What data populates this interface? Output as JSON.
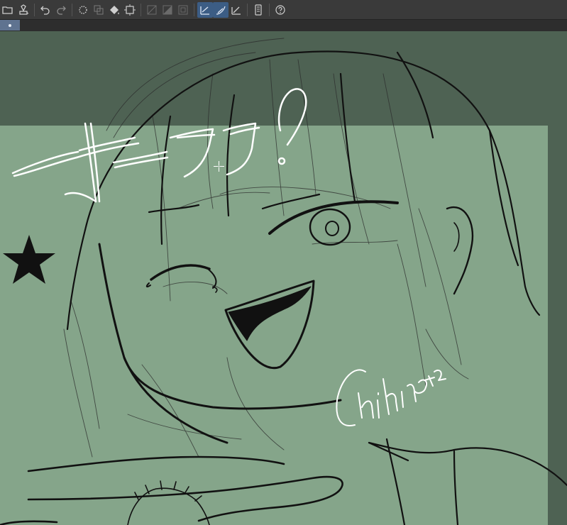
{
  "toolbar": {
    "tools": [
      {
        "name": "open-file-icon",
        "active": false
      },
      {
        "name": "save-file-icon",
        "active": false
      },
      {
        "name": "undo-icon",
        "active": false
      },
      {
        "name": "redo-icon",
        "active": false
      },
      {
        "name": "clear-icon",
        "active": false
      },
      {
        "name": "cut-icon",
        "active": false
      },
      {
        "name": "fill-icon",
        "active": false
      },
      {
        "name": "transform-icon",
        "active": false
      },
      {
        "name": "select-all-icon",
        "active": false
      },
      {
        "name": "invert-selection-icon",
        "active": false
      },
      {
        "name": "deselect-icon",
        "active": false
      },
      {
        "name": "snap-to-ruler-icon",
        "active": true
      },
      {
        "name": "snap-to-special-ruler-icon",
        "active": true
      },
      {
        "name": "snap-to-grid-icon",
        "active": false
      },
      {
        "name": "device-icon",
        "active": false
      },
      {
        "name": "help-icon",
        "active": false
      }
    ]
  },
  "colors": {
    "toolbar_bg": "#3a3a3a",
    "canvas_bg": "#4e6253",
    "page_bg": "#85a58a",
    "active_tool": "#3c5d85",
    "tab_bg": "#5f7390",
    "line_art": "#111111",
    "white_text": "#ffffff"
  },
  "artwork": {
    "katakana_text": "オーララ!",
    "signature": "Chihiro22"
  }
}
